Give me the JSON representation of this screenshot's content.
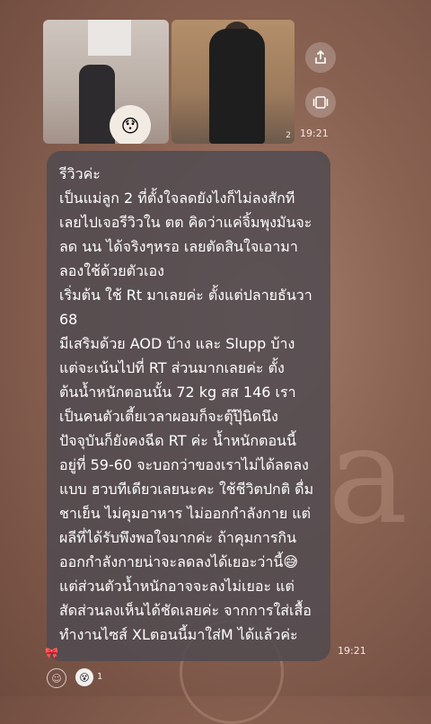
{
  "chat": {
    "photo_count": "2",
    "photo_time": "19:21",
    "message_time": "19:21",
    "message_lines": [
      "รีวิวค่ะ",
      "เป็นแม่ลูก 2 ที่ตั้งใจลดยังไงก็ไม่ลงสักที",
      "เลยไปเจอรีวิวใน ตต คิดว่าแค่จิ้มพุงมันจะ",
      "ลด นน  ได้จริงๆหรอ เลยตัดสินใจเอามา",
      "ลองใช้ด้วยตัวเอง",
      "เริ่มต้น ใช้ Rt มาเลยค่ะ ตั้งแต่ปลายธันวา",
      "68",
      "มีเสริมด้วย AOD บ้าง และ Slupp บ้าง",
      "แต่จะเน้นไปที่ RT ส่วนมากเลยค่ะ ตั้ง",
      "ต้นน้ำหนักตอนนั้น 72 kg สส 146 เรา",
      "เป็นคนตัวเตี้ยเวลาผอมก็จะตุ๊ปุ๊นิดนึง",
      "ปัจจุบันก็ยังคงฉีด RT ค่ะ น้ำหนักตอนนี้",
      "อยู่ที่ 59-60 จะบอกว่าของเราไม่ได้ลดลง",
      "แบบ ฮวบทีเดียวเลยนะคะ ใช้ชีวิตปกติ ดื่ม",
      "ชาเย็น ไม่คุมอาหาร ไม่ออกกำลังกาย แต่",
      "ผลีที่ได้รับพึงพอใจมากค่ะ ถ้าคุมการกิน",
      "ออกกำลังกายน่าจะลดลงได้เยอะว่านี้😅",
      "แต่ส่วนตัวน้ำหนักอาจจะลงไม่เยอะ แต่",
      "สัดส่วนลงเห็นได้ชัดเลยค่ะ จากการใส่เสื้อ",
      "ทำงานไซส์ XLตอนนี้มาใส่M ได้แล้วค่ะ"
    ],
    "reaction_count": "1",
    "background_letter": "a"
  },
  "icons": {
    "share": "share-icon",
    "gallery": "gallery-icon",
    "emoji": "smiley-icon",
    "ribbon": "ribbon-icon"
  }
}
